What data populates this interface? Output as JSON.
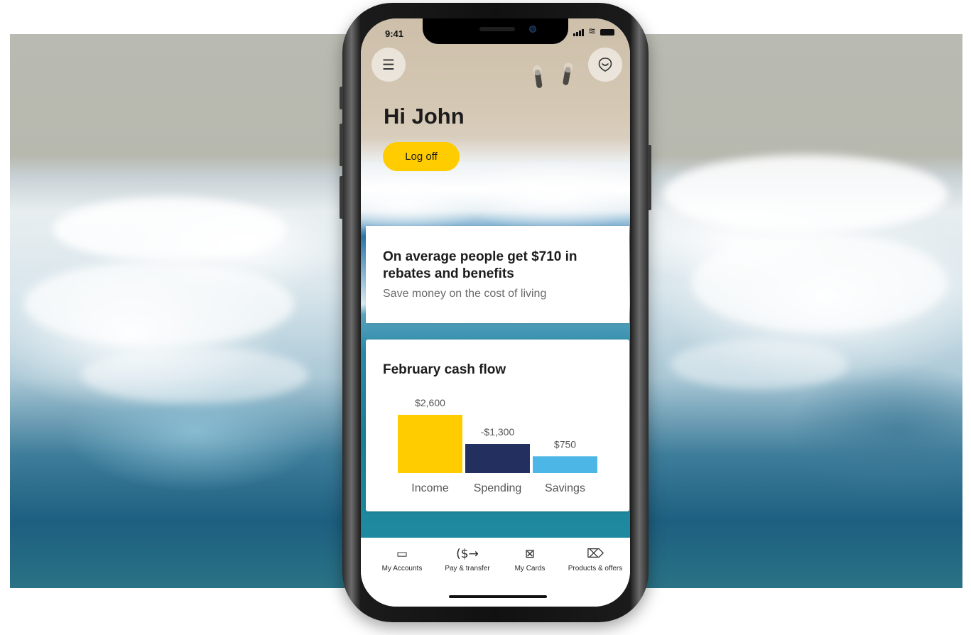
{
  "status_bar": {
    "time": "9:41"
  },
  "header": {
    "menu_icon": "hamburger-menu-icon",
    "assistant_icon": "chat-bubble-icon",
    "greeting": "Hi John",
    "logoff_label": "Log off"
  },
  "promo_card": {
    "title": "On average people get $710 in rebates and benefits",
    "subtitle": "Save money on the cost of living"
  },
  "cashflow_card": {
    "title": "February cash flow"
  },
  "chart_data": {
    "type": "bar",
    "title": "February cash flow",
    "categories": [
      "Income",
      "Spending",
      "Savings"
    ],
    "values": [
      2600,
      1300,
      750
    ],
    "value_labels": [
      "$2,600",
      "-$1,300",
      "$750"
    ],
    "colors": [
      "#ffcc00",
      "#23305f",
      "#4cb6e6"
    ],
    "xlabel": "",
    "ylabel": "",
    "grid": false
  },
  "tab_bar": {
    "items": [
      {
        "label": "My Accounts",
        "icon": "wallet-icon",
        "glyph": "▭"
      },
      {
        "label": "Pay & transfer",
        "icon": "dollar-transfer-icon",
        "glyph": "($→"
      },
      {
        "label": "My Cards",
        "icon": "card-icon",
        "glyph": "⊠"
      },
      {
        "label": "Products & offers",
        "icon": "tag-icon",
        "glyph": "⌦"
      }
    ]
  },
  "colors": {
    "accent": "#ffcc00",
    "navy": "#23305f",
    "sky": "#4cb6e6"
  }
}
